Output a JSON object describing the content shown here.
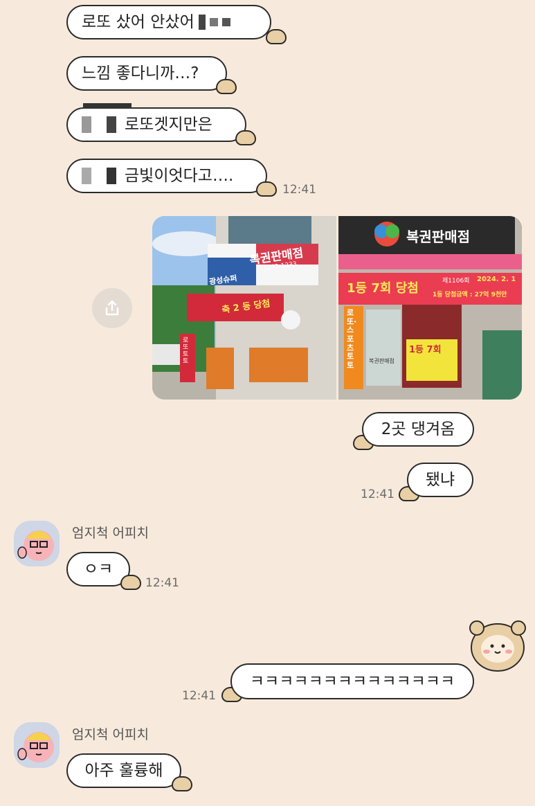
{
  "messages": {
    "m1": "로또 샀어 안샀어",
    "m2": "느낌 좋다니까…?",
    "m3": "로또겟지만은",
    "m4": "금빛이엇다고….",
    "m5": "2곳 댕겨옴",
    "m6": "됐냐",
    "m7": "ㅇㅋ",
    "m8": "ㅋㅋㅋㅋㅋㅋㅋㅋㅋㅋㅋㅋㅋㅋ",
    "m9": "아주 훌륭해"
  },
  "times": {
    "t1": "12:41",
    "t2": "12:41",
    "t3": "12:41",
    "t4": "12:41"
  },
  "sender": {
    "name1": "엄지척 어피치",
    "name2": "엄지척 어피치"
  },
  "photos": {
    "left": {
      "shop_sign": "복권판매점",
      "store_name": "광성슈퍼",
      "phone": "1262-1233",
      "banner": "축 2 등 당첨",
      "pole_text": "로또 토토"
    },
    "right": {
      "shop_sign": "복권판매점",
      "banner_main": "1등 7회 당첨",
      "banner_sub": "1등 당첨금액 : 27억 9천만",
      "round": "제1106회",
      "date": "2024. 2. 1",
      "pole_text": "로또·스포츠토토",
      "window_text": "1등 7회",
      "door_text": "복권판매점"
    }
  },
  "icons": {
    "share": "share-icon",
    "avatar": "peach-avatar",
    "sticker": "bear-sticker"
  },
  "colors": {
    "background": "#f7eadc",
    "bubble": "#ffffff",
    "border": "#2b2b2b",
    "paw": "#e9cfa5"
  }
}
